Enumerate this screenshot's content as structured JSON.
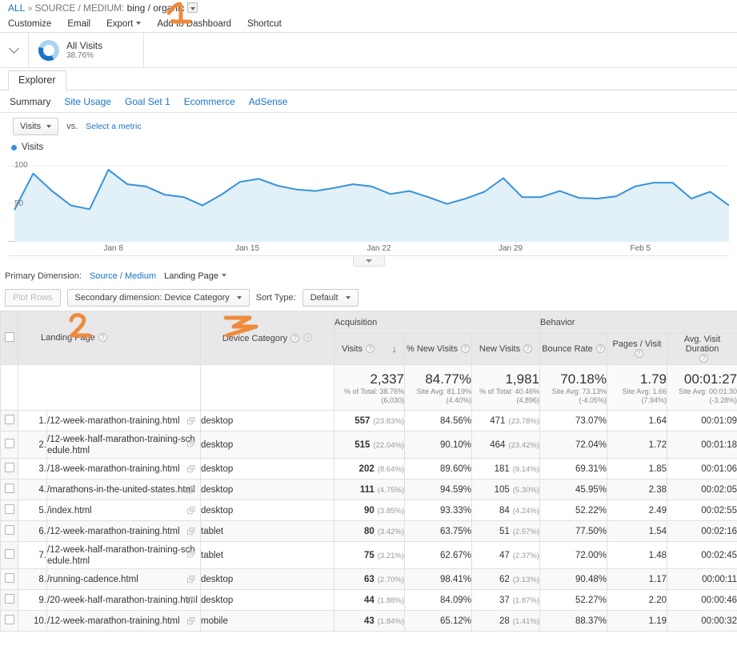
{
  "breadcrumb": {
    "all": "ALL",
    "separator": "»",
    "dimension_label": "SOURCE / MEDIUM:",
    "dimension_value": "bing / organic"
  },
  "action_bar": {
    "items": [
      {
        "label": "Customize",
        "caret": false
      },
      {
        "label": "Email",
        "caret": false
      },
      {
        "label": "Export",
        "caret": true
      },
      {
        "label": "Add to Dashboard",
        "caret": false
      },
      {
        "label": "Shortcut",
        "caret": false
      }
    ]
  },
  "segment": {
    "name": "All Visits",
    "percent": "38.76%"
  },
  "explorer": {
    "tab_label": "Explorer",
    "subtabs": [
      {
        "label": "Summary",
        "active": true
      },
      {
        "label": "Site Usage",
        "active": false
      },
      {
        "label": "Goal Set 1",
        "active": false
      },
      {
        "label": "Ecommerce",
        "active": false
      },
      {
        "label": "AdSense",
        "active": false
      }
    ]
  },
  "metric_selector": {
    "selected": "Visits",
    "vs": "vs.",
    "select_metric": "Select a metric"
  },
  "chart_data": {
    "type": "area",
    "title": "Visits",
    "legend": [
      "Visits"
    ],
    "legend_position": "top-left",
    "color": "#3593d9",
    "fill": "#e3f0f9",
    "grid": true,
    "ylabel": "",
    "xlabel": "",
    "ylim": [
      0,
      112
    ],
    "yticks": [
      50,
      100
    ],
    "ytick_labels": [
      "50",
      "100"
    ],
    "xtick_labels": [
      "Jan 8",
      "Jan 15",
      "Jan 22",
      "Jan 29",
      "Feb 5"
    ],
    "xtick_indices": [
      5,
      12,
      19,
      26,
      33
    ],
    "x": [
      1,
      2,
      3,
      4,
      5,
      6,
      7,
      8,
      9,
      10,
      11,
      12,
      13,
      14,
      15,
      16,
      17,
      18,
      19,
      20,
      21,
      22,
      23,
      24,
      25,
      26,
      27,
      28,
      29,
      30,
      31,
      32,
      33,
      34,
      35,
      36,
      37,
      38,
      39
    ],
    "values": [
      42,
      90,
      67,
      48,
      43,
      95,
      76,
      73,
      62,
      59,
      48,
      62,
      79,
      83,
      74,
      69,
      67,
      71,
      76,
      73,
      63,
      67,
      59,
      50,
      57,
      66,
      84,
      59,
      59,
      67,
      58,
      57,
      60,
      73,
      78,
      78,
      57,
      66,
      48
    ]
  },
  "dimension_controls": {
    "primary_label": "Primary Dimension:",
    "primary_options": [
      {
        "label": "Source / Medium",
        "active": false
      },
      {
        "label": "Landing Page",
        "active": true
      }
    ],
    "plot_rows": "Plot Rows",
    "secondary_dimension": "Secondary dimension: Device Category",
    "sort_type_label": "Sort Type:",
    "sort_type_value": "Default"
  },
  "table": {
    "group_headers": [
      {
        "label": "Acquisition",
        "span": 3
      },
      {
        "label": "Behavior",
        "span": 3
      }
    ],
    "columns": [
      {
        "label": "Landing Page",
        "help": true,
        "sorted": false
      },
      {
        "label": "Device Category",
        "help": true,
        "plus": true,
        "sorted": false
      },
      {
        "label": "Visits",
        "help": true,
        "sorted": true,
        "sort_dir": "desc"
      },
      {
        "label": "% New Visits",
        "help": true,
        "sorted": false
      },
      {
        "label": "New Visits",
        "help": true,
        "sorted": false
      },
      {
        "label": "Bounce Rate",
        "help": true,
        "sorted": false
      },
      {
        "label": "Pages / Visit",
        "help": true,
        "sorted": false
      },
      {
        "label": "Avg. Visit Duration",
        "help": true,
        "sorted": false
      }
    ],
    "totals": [
      {
        "value": "2,337",
        "sub1": "% of Total: 38.76%",
        "sub2": "(6,030)"
      },
      {
        "value": "84.77%",
        "sub1": "Site Avg: 81.19%",
        "sub2": "(4.40%)"
      },
      {
        "value": "1,981",
        "sub1": "% of Total: 40.46%",
        "sub2": "(4,896)"
      },
      {
        "value": "70.18%",
        "sub1": "Site Avg: 73.13%",
        "sub2": "(-4.05%)"
      },
      {
        "value": "1.79",
        "sub1": "Site Avg: 1.66",
        "sub2": "(7.94%)"
      },
      {
        "value": "00:01:27",
        "sub1": "Site Avg: 00:01:30",
        "sub2": "(-3.28%)"
      }
    ],
    "rows": [
      {
        "index": "1.",
        "landing_page": "/12-week-marathon-training.html",
        "device_category": "desktop",
        "visits": "557",
        "visits_pct": "(23.83%)",
        "new_visits_pct": "84.56%",
        "new_visits": "471",
        "new_visits_share": "(23.78%)",
        "bounce_rate": "73.07%",
        "pages_per_visit": "1.64",
        "avg_duration": "00:01:09"
      },
      {
        "index": "2.",
        "landing_page": "/12-week-half-marathon-training-schedule.html",
        "device_category": "desktop",
        "visits": "515",
        "visits_pct": "(22.04%)",
        "new_visits_pct": "90.10%",
        "new_visits": "464",
        "new_visits_share": "(23.42%)",
        "bounce_rate": "72.04%",
        "pages_per_visit": "1.72",
        "avg_duration": "00:01:18"
      },
      {
        "index": "3.",
        "landing_page": "/18-week-marathon-training.html",
        "device_category": "desktop",
        "visits": "202",
        "visits_pct": "(8.64%)",
        "new_visits_pct": "89.60%",
        "new_visits": "181",
        "new_visits_share": "(9.14%)",
        "bounce_rate": "69.31%",
        "pages_per_visit": "1.85",
        "avg_duration": "00:01:06"
      },
      {
        "index": "4.",
        "landing_page": "/marathons-in-the-united-states.html",
        "device_category": "desktop",
        "visits": "111",
        "visits_pct": "(4.75%)",
        "new_visits_pct": "94.59%",
        "new_visits": "105",
        "new_visits_share": "(5.30%)",
        "bounce_rate": "45.95%",
        "pages_per_visit": "2.38",
        "avg_duration": "00:02:05"
      },
      {
        "index": "5.",
        "landing_page": "/index.html",
        "device_category": "desktop",
        "visits": "90",
        "visits_pct": "(3.85%)",
        "new_visits_pct": "93.33%",
        "new_visits": "84",
        "new_visits_share": "(4.24%)",
        "bounce_rate": "52.22%",
        "pages_per_visit": "2.49",
        "avg_duration": "00:02:55"
      },
      {
        "index": "6.",
        "landing_page": "/12-week-marathon-training.html",
        "device_category": "tablet",
        "visits": "80",
        "visits_pct": "(3.42%)",
        "new_visits_pct": "63.75%",
        "new_visits": "51",
        "new_visits_share": "(2.57%)",
        "bounce_rate": "77.50%",
        "pages_per_visit": "1.54",
        "avg_duration": "00:02:16"
      },
      {
        "index": "7.",
        "landing_page": "/12-week-half-marathon-training-schedule.html",
        "device_category": "tablet",
        "visits": "75",
        "visits_pct": "(3.21%)",
        "new_visits_pct": "62.67%",
        "new_visits": "47",
        "new_visits_share": "(2.37%)",
        "bounce_rate": "72.00%",
        "pages_per_visit": "1.48",
        "avg_duration": "00:02:45"
      },
      {
        "index": "8.",
        "landing_page": "/running-cadence.html",
        "device_category": "desktop",
        "visits": "63",
        "visits_pct": "(2.70%)",
        "new_visits_pct": "98.41%",
        "new_visits": "62",
        "new_visits_share": "(3.13%)",
        "bounce_rate": "90.48%",
        "pages_per_visit": "1.17",
        "avg_duration": "00:00:11"
      },
      {
        "index": "9.",
        "landing_page": "/20-week-half-marathon-training.html",
        "device_category": "desktop",
        "visits": "44",
        "visits_pct": "(1.88%)",
        "new_visits_pct": "84.09%",
        "new_visits": "37",
        "new_visits_share": "(1.87%)",
        "bounce_rate": "52.27%",
        "pages_per_visit": "2.20",
        "avg_duration": "00:00:46"
      },
      {
        "index": "10.",
        "landing_page": "/12-week-marathon-training.html",
        "device_category": "mobile",
        "visits": "43",
        "visits_pct": "(1.84%)",
        "new_visits_pct": "65.12%",
        "new_visits": "28",
        "new_visits_share": "(1.41%)",
        "bounce_rate": "88.37%",
        "pages_per_visit": "1.19",
        "avg_duration": "00:00:32"
      }
    ]
  },
  "annotations": {
    "color": "#ee8b3c",
    "marks": [
      {
        "label": "1",
        "target": "shortcut"
      },
      {
        "label": "2",
        "target": "landing-page-column"
      },
      {
        "label": "3",
        "target": "device-category-column"
      }
    ]
  }
}
